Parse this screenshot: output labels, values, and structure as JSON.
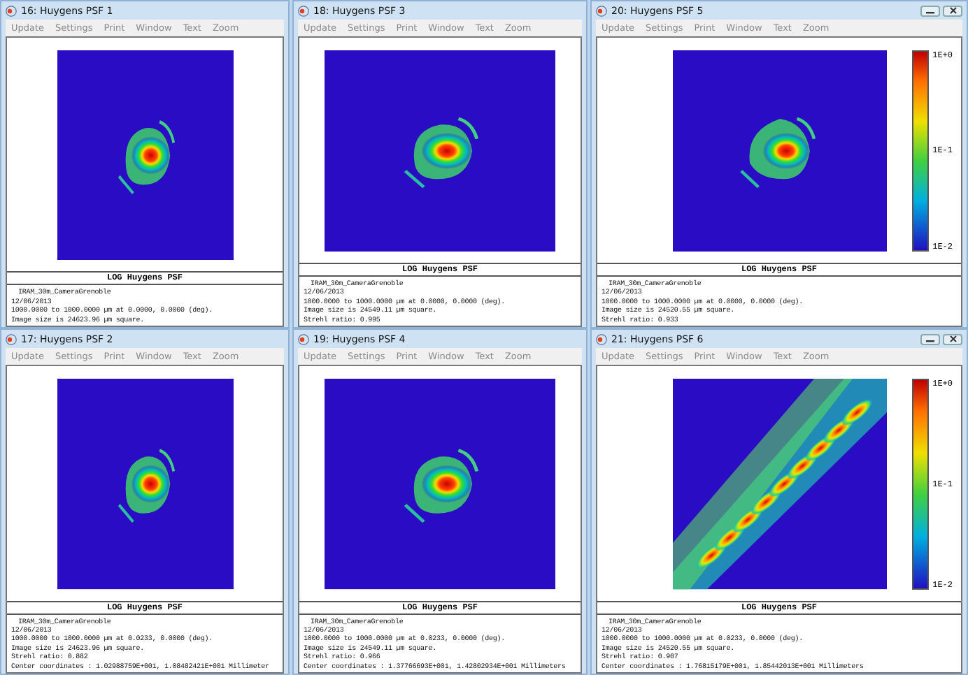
{
  "windows": [
    {
      "title": "16: Huygens PSF 1",
      "window_buttons": false,
      "menu": [
        "Update",
        "Settings",
        "Print",
        "Window",
        "Text",
        "Zoom"
      ],
      "plot_title": "LOG Huygens PSF",
      "lines": [
        "IRAM_30m_CameraGrenoble",
        "12/06/2013",
        "1000.0000 to 1000.0000 µm at 0.0000, 0.0000 (deg).",
        "Image size is 24623.96 µm square."
      ]
    },
    {
      "title": "18: Huygens PSF 3",
      "window_buttons": false,
      "menu": [
        "Update",
        "Settings",
        "Print",
        "Window",
        "Text",
        "Zoom"
      ],
      "plot_title": "LOG Huygens PSF",
      "lines": [
        "IRAM_30m_CameraGrenoble",
        "12/06/2013",
        "1000.0000 to 1000.0000 µm at 0.0000, 0.0000 (deg).",
        "Image size is 24549.11 µm square.",
        "Strehl ratio: 0.995"
      ]
    },
    {
      "title": "20: Huygens PSF 5",
      "window_buttons": true,
      "menu": [
        "Update",
        "Settings",
        "Print",
        "Window",
        "Text",
        "Zoom"
      ],
      "plot_title": "LOG Huygens PSF",
      "colorbar": [
        "1E+0",
        "1E-1",
        "1E-2"
      ],
      "lines": [
        "IRAM_30m_CameraGrenoble",
        "12/06/2013",
        "1000.0000 to 1000.0000 µm at 0.0000, 0.0000 (deg).",
        "Image size is 24520.55 µm square.",
        "Strehl ratio: 0.933"
      ]
    },
    {
      "title": "17: Huygens PSF 2",
      "window_buttons": false,
      "menu": [
        "Update",
        "Settings",
        "Print",
        "Window",
        "Text",
        "Zoom"
      ],
      "plot_title": "LOG Huygens PSF",
      "lines": [
        "IRAM_30m_CameraGrenoble",
        "12/06/2013",
        "1000.0000 to 1000.0000 µm at 0.0233, 0.0000 (deg).",
        "Image size is 24623.96 µm square.",
        "Strehl ratio: 0.882",
        "Center coordinates : 1.02988759E+001, 1.08482421E+001 Millimeter"
      ]
    },
    {
      "title": "19: Huygens PSF 4",
      "window_buttons": false,
      "menu": [
        "Update",
        "Settings",
        "Print",
        "Window",
        "Text",
        "Zoom"
      ],
      "plot_title": "LOG Huygens PSF",
      "lines": [
        "IRAM_30m_CameraGrenoble",
        "12/06/2013",
        "1000.0000 to 1000.0000 µm at 0.0233, 0.0000 (deg).",
        "Image size is 24549.11 µm square.",
        "Strehl ratio: 0.966",
        "Center coordinates : 1.37766693E+001, 1.42802934E+001 Millimeters"
      ]
    },
    {
      "title": "21: Huygens PSF 6",
      "window_buttons": true,
      "menu": [
        "Update",
        "Settings",
        "Print",
        "Window",
        "Text",
        "Zoom"
      ],
      "plot_title": "LOG Huygens PSF",
      "colorbar": [
        "1E+0",
        "1E-1",
        "1E-2"
      ],
      "lines": [
        "IRAM_30m_CameraGrenoble",
        "12/06/2013",
        "1000.0000 to 1000.0000 µm at 0.0233, 0.0000 (deg).",
        "Image size is 24520.55 µm square.",
        "Strehl ratio: 0.907",
        "Center coordinates : 1.76815179E+001, 1.85442013E+001 Millimeters"
      ]
    }
  ]
}
